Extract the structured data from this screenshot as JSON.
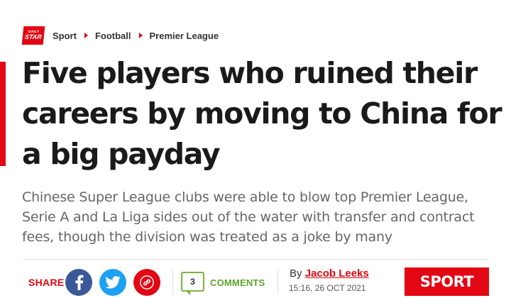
{
  "logo": {
    "top": "DAILY",
    "main": "STAR"
  },
  "breadcrumb": [
    {
      "label": "Sport"
    },
    {
      "label": "Football"
    },
    {
      "label": "Premier League"
    }
  ],
  "article": {
    "headline": "Five players who ruined their careers by moving to China for a big payday",
    "standfirst": "Chinese Super League clubs were able to blow top Premier League, Serie A and La Liga sides out of the water with transfer and contract fees, though the division was treated as a joke by many"
  },
  "share": {
    "label": "SHARE",
    "icons": [
      "facebook-icon",
      "twitter-icon",
      "link-icon"
    ]
  },
  "comments": {
    "count": "3",
    "label": "COMMENTS"
  },
  "byline": {
    "prefix": "By",
    "author": "Jacob Leeks",
    "timestamp": "15:16, 26 OCT 2021"
  },
  "section_badge": "SPORT",
  "colors": {
    "brand_red": "#e30613",
    "facebook": "#3b5998",
    "twitter": "#1da1f2",
    "comments_green": "#5fa12f"
  }
}
